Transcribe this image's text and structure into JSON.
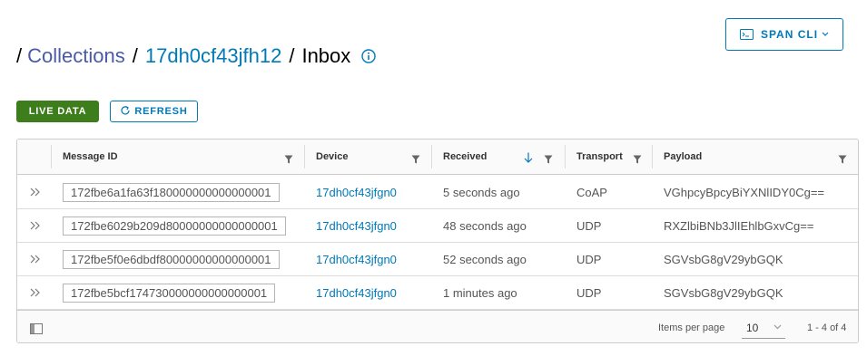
{
  "header": {
    "span_cli_label": "SPAN CLI",
    "breadcrumb": {
      "sep": "/",
      "collections": "Collections",
      "collection_id": "17dh0cf43jfh12",
      "current": "Inbox"
    }
  },
  "toolbar": {
    "live_label": "LIVE DATA",
    "refresh_label": "REFRESH"
  },
  "table": {
    "columns": {
      "message_id": "Message ID",
      "device": "Device",
      "received": "Received",
      "transport": "Transport",
      "payload": "Payload"
    },
    "rows": [
      {
        "message_id": "172fbe6a1fa63f180000000000000001",
        "device": "17dh0cf43jfgn0",
        "received": "5 seconds ago",
        "transport": "CoAP",
        "payload": "VGhpcyBpcyBiYXNlIDY0Cg=="
      },
      {
        "message_id": "172fbe6029b209d80000000000000001",
        "device": "17dh0cf43jfgn0",
        "received": "48 seconds ago",
        "transport": "UDP",
        "payload": "RXZlbiBNb3JlIEhlbGxvCg=="
      },
      {
        "message_id": "172fbe5f0e6dbdf80000000000000001",
        "device": "17dh0cf43jfgn0",
        "received": "52 seconds ago",
        "transport": "UDP",
        "payload": "SGVsbG8gV29ybGQK"
      },
      {
        "message_id": "172fbe5bcf174730000000000000001",
        "device": "17dh0cf43jfgn0",
        "received": "1 minutes ago",
        "transport": "UDP",
        "payload": "SGVsbG8gV29ybGQK"
      }
    ]
  },
  "footer": {
    "items_per_page_label": "Items per page",
    "page_size": "10",
    "range": "1 - 4 of 4"
  },
  "colors": {
    "accent": "#0079b8",
    "live": "#3d7d1b"
  }
}
